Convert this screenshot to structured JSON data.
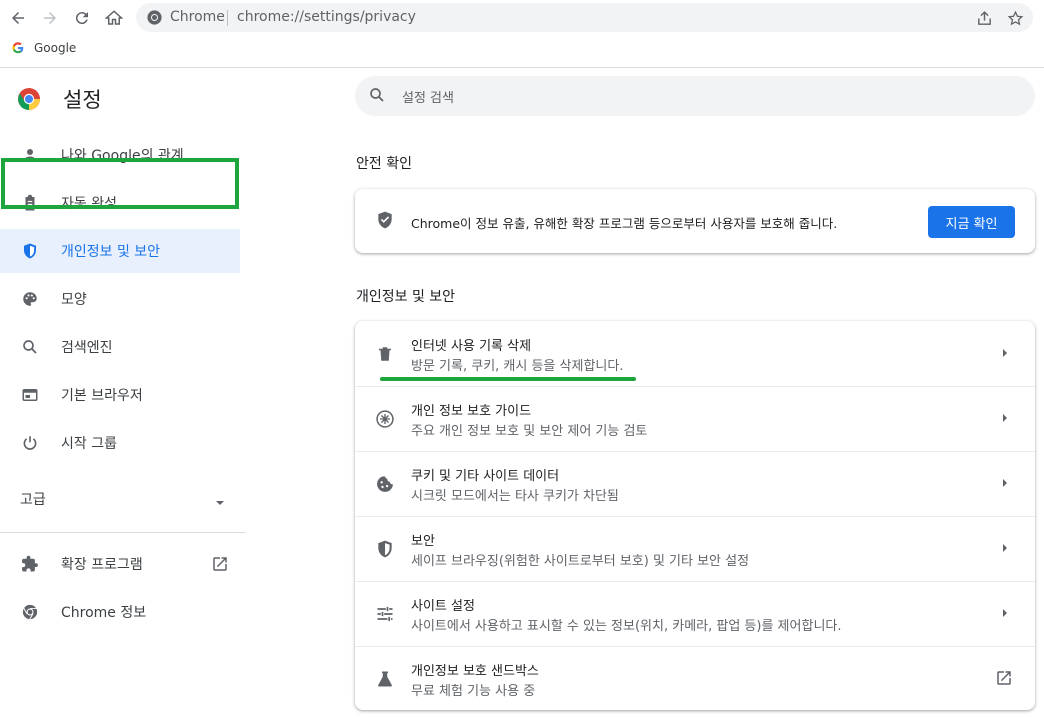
{
  "browser": {
    "omnibox_chip": "Chrome",
    "url": "chrome://settings/privacy",
    "bookmark_label": "Google"
  },
  "sidebar": {
    "title": "설정",
    "items": [
      {
        "label": "나와 Google의 관계",
        "icon": "person-icon"
      },
      {
        "label": "자동 완성",
        "icon": "clipboard-icon"
      },
      {
        "label": "개인정보 및 보안",
        "icon": "shield-icon"
      },
      {
        "label": "모양",
        "icon": "palette-icon"
      },
      {
        "label": "검색엔진",
        "icon": "search-icon"
      },
      {
        "label": "기본 브라우저",
        "icon": "browser-icon"
      },
      {
        "label": "시작 그룹",
        "icon": "power-icon"
      }
    ],
    "advanced_label": "고급",
    "extensions_label": "확장 프로그램",
    "about_label": "Chrome 정보"
  },
  "search": {
    "placeholder": "설정 검색"
  },
  "safety_check": {
    "section_title": "안전 확인",
    "text": "Chrome이 정보 유출, 유해한 확장 프로그램 등으로부터 사용자를 보호해 줍니다.",
    "button_label": "지금 확인"
  },
  "privacy": {
    "section_title": "개인정보 및 보안",
    "rows": [
      {
        "title": "인터넷 사용 기록 삭제",
        "subtitle": "방문 기록, 쿠키, 캐시 등을 삭제합니다.",
        "icon": "trash-icon"
      },
      {
        "title": "개인 정보 보호 가이드",
        "subtitle": "주요 개인 정보 보호 및 보안 제어 기능 검토",
        "icon": "guide-icon"
      },
      {
        "title": "쿠키 및 기타 사이트 데이터",
        "subtitle": "시크릿 모드에서는 타사 쿠키가 차단됨",
        "icon": "cookie-icon"
      },
      {
        "title": "보안",
        "subtitle": "세이프 브라우징(위험한 사이트로부터 보호) 및 기타 보안 설정",
        "icon": "security-shield-icon"
      },
      {
        "title": "사이트 설정",
        "subtitle": "사이트에서 사용하고 표시할 수 있는 정보(위치, 카메라, 팝업 등)를 제어합니다.",
        "icon": "tune-icon"
      },
      {
        "title": "개인정보 보호 샌드박스",
        "subtitle": "무료 체험 기능 사용 중",
        "icon": "flask-icon"
      }
    ]
  },
  "colors": {
    "accent": "#1a73e8",
    "highlight": "#1fa53d",
    "active_bg": "#e8f0fe"
  }
}
